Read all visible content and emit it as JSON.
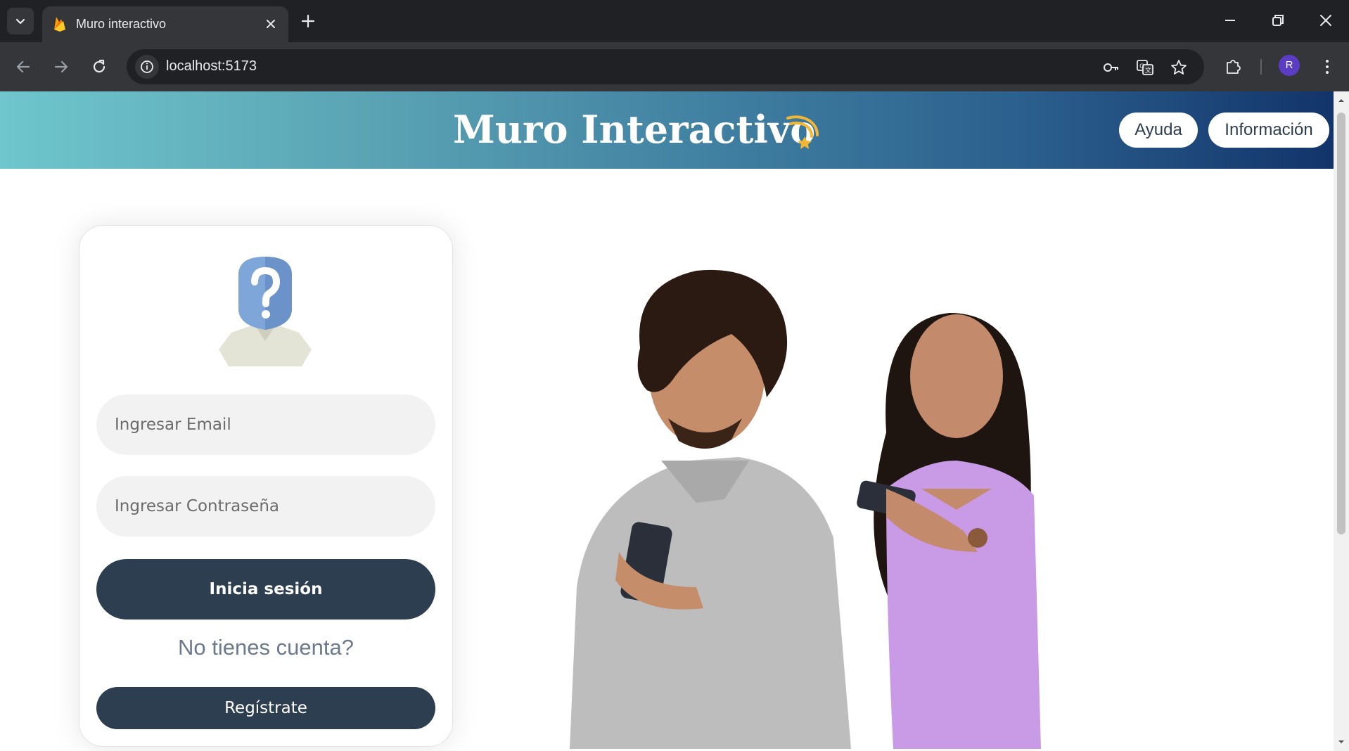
{
  "browser": {
    "tab_title": "Muro interactivo",
    "url": "localhost:5173",
    "profile_initial": "R"
  },
  "header": {
    "title": "Muro Interactivo",
    "help_label": "Ayuda",
    "info_label": "Información"
  },
  "login": {
    "email_placeholder": "Ingresar Email",
    "password_placeholder": "Ingresar Contraseña",
    "login_label": "Inicia sesión",
    "no_account_text": "No tienes cuenta?",
    "register_label": "Regístrate"
  },
  "colors": {
    "header_gradient_start": "#6fc6cc",
    "header_gradient_end": "#12346a",
    "primary_button": "#2c3e50",
    "input_background": "#f2f2f2",
    "chrome_dark": "#202124"
  },
  "icons": [
    "tab-search-icon",
    "firebase-icon",
    "close-icon",
    "plus-icon",
    "minimize-icon",
    "restore-icon",
    "back-icon",
    "forward-icon",
    "reload-icon",
    "info-icon",
    "key-icon",
    "translate-icon",
    "star-icon",
    "extensions-icon",
    "more-icon",
    "comet-icon",
    "unknown-user-icon"
  ]
}
